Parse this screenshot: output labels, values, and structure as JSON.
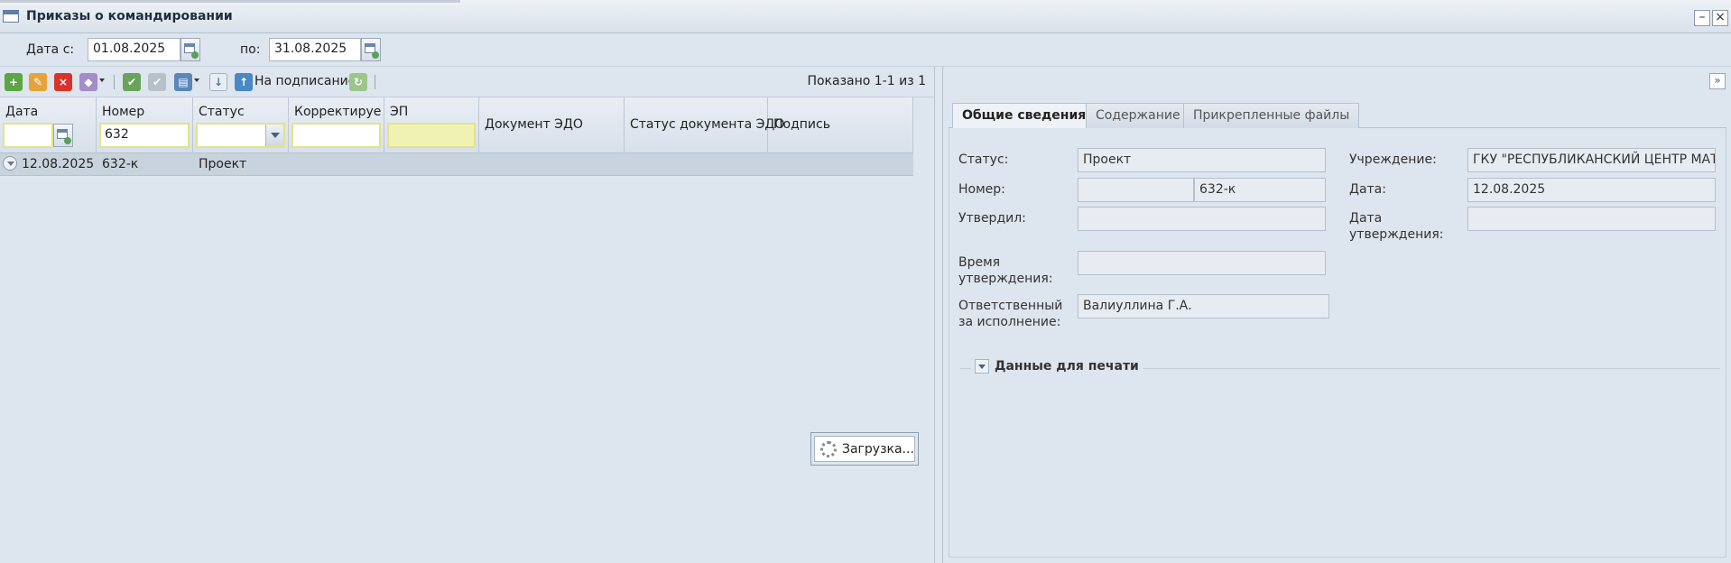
{
  "window": {
    "title": "Приказы о командировании"
  },
  "filter": {
    "date_from_label": "Дата с:",
    "date_from_value": "01.08.2025",
    "date_to_label": "по:",
    "date_to_value": "31.08.2025"
  },
  "toolbar": {
    "sign_label": "На подписание",
    "shown": "Показано 1-1 из 1"
  },
  "grid": {
    "columns": [
      "Дата",
      "Номер",
      "Статус",
      "Корректируе...",
      "ЭП",
      "Документ ЭДО",
      "Статус документа ЭДО",
      "Подпись"
    ],
    "filters": {
      "number": "632"
    },
    "rows": [
      {
        "date": "12.08.2025",
        "number": "632-к",
        "status": "Проект"
      }
    ]
  },
  "loading": {
    "text": "Загрузка..."
  },
  "details": {
    "tabs": [
      "Общие сведения",
      "Содержание",
      "Прикрепленные файлы"
    ],
    "status_label": "Статус:",
    "status_value": "Проект",
    "number_label": "Номер:",
    "number_prefix": "",
    "number_value": "632-к",
    "approved_by_label": "Утвердил:",
    "approved_by_value": "",
    "approve_time_label_1": "Время",
    "approve_time_label_2": "утверждения:",
    "approve_time_value": "",
    "responsible_label_1": "Ответственный",
    "responsible_label_2": "за исполнение:",
    "responsible_value": "Валиуллина Г.А.",
    "institution_label": "Учреждение:",
    "institution_value": "ГКУ \"РЕСПУБЛИКАНСКИЙ ЦЕНТР МАТЕ",
    "date_label": "Дата:",
    "date_value": "12.08.2025",
    "approve_date_label_1": "Дата",
    "approve_date_label_2": "утверждения:",
    "approve_date_value": "",
    "print_section": "Данные для печати"
  },
  "colors": {
    "add": "#5aa642",
    "edit": "#e6a23c",
    "delete": "#d9342b",
    "accent": "#5d7fa8"
  }
}
